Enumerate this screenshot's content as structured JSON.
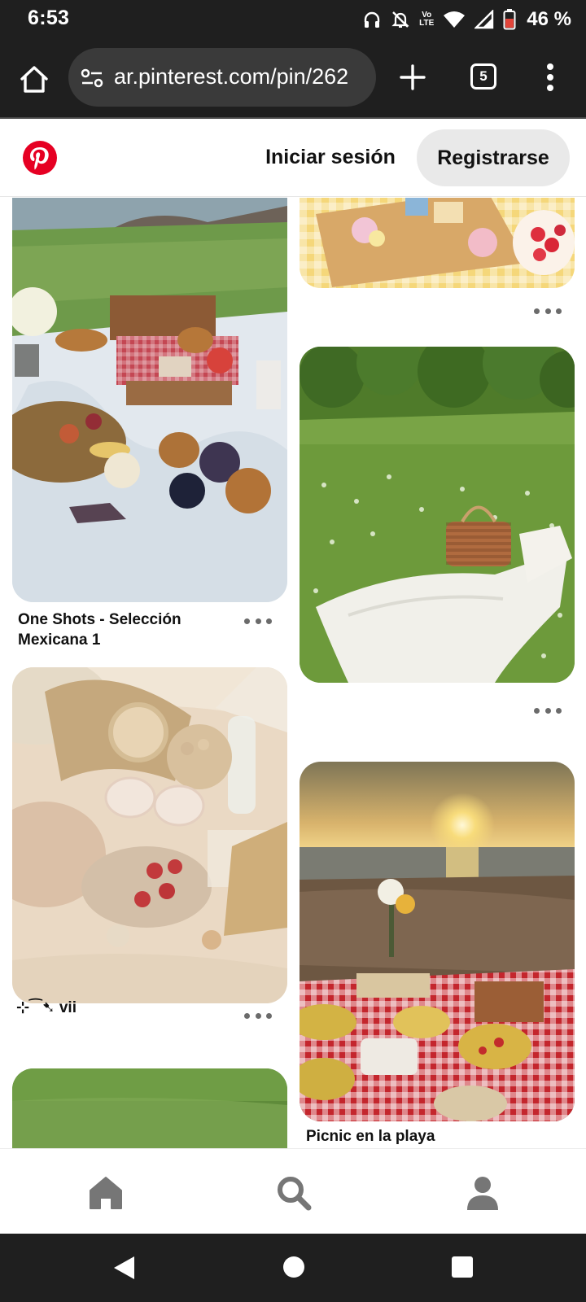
{
  "status_bar": {
    "time": "6:53",
    "volte_top": "Vo",
    "volte_bottom": "LTE",
    "battery_percent": "46 %",
    "icons": [
      "headphones-icon",
      "notifications-off-icon",
      "volte-icon",
      "data-arrows-icon",
      "wifi-icon",
      "cell-signal-icon",
      "battery-icon"
    ]
  },
  "browser": {
    "url": "ar.pinterest.com/pin/262",
    "tab_count": "5",
    "icons": [
      "home-icon",
      "site-settings-icon",
      "plus-icon",
      "tab-switcher-icon",
      "more-vert-icon"
    ]
  },
  "header": {
    "login_label": "Iniciar sesión",
    "signup_label": "Registrarse",
    "brand_color": "#E60023"
  },
  "feed": {
    "left_column": [
      {
        "title": "One Shots - Selección Mexicana 1"
      },
      {
        "title": "⊹⁀➷ vii"
      },
      {
        "title": ""
      }
    ],
    "right_column": [
      {
        "title": ""
      },
      {
        "title": ""
      },
      {
        "title": "Picnic en la playa"
      }
    ]
  },
  "bottom_nav": {
    "items": [
      "home-icon",
      "search-icon",
      "profile-icon"
    ]
  },
  "system_nav": {
    "items": [
      "back-icon",
      "home-circle-icon",
      "recents-icon"
    ]
  }
}
